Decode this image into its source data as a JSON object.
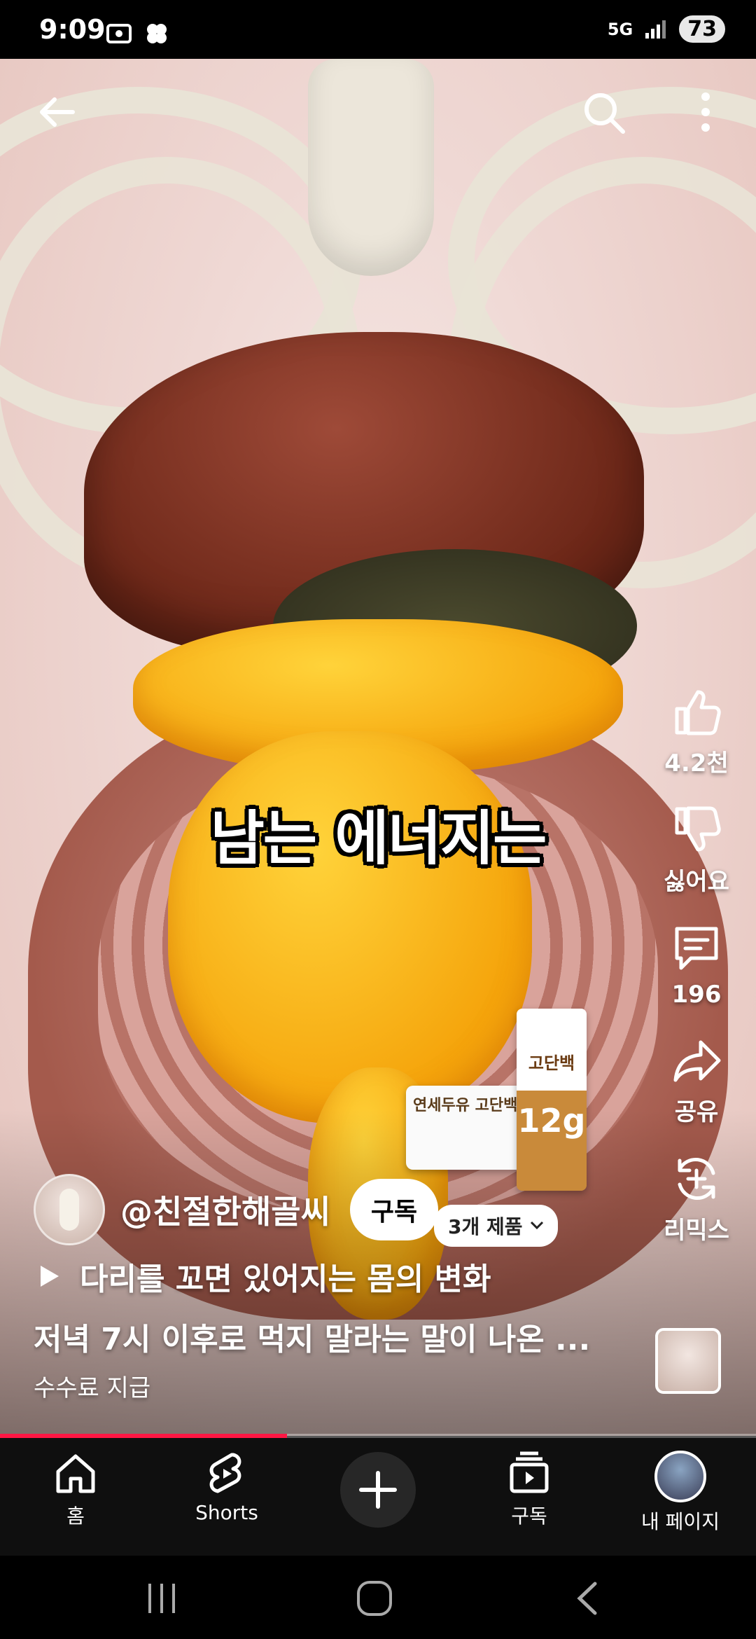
{
  "status_bar": {
    "time": "9:09",
    "network": "5G",
    "battery": "73"
  },
  "video": {
    "caption": "남는 에너지는",
    "progress": 0.38
  },
  "actions": {
    "like_count": "4.2천",
    "dislike_label": "싫어요",
    "comment_count": "196",
    "share_label": "공유",
    "remix_label": "리믹스"
  },
  "channel": {
    "handle": "@친절한해골씨",
    "subscribe_label": "구독"
  },
  "product": {
    "pill_label": "3개 제품",
    "box_text": "연세두유 고단백",
    "carton_title": "고단백",
    "carton_grams": "12g"
  },
  "related_video": "다리를 꼬면 있어지는 몸의 변화",
  "description": "저녁 7시 이후로 먹지 말라는 말이 나온 ...",
  "paid_promotion": "수수료 지급",
  "bottom_nav": {
    "home": "홈",
    "shorts": "Shorts",
    "subscriptions": "구독",
    "my_page": "내 페이지"
  },
  "colors": {
    "accent": "#ff1744",
    "nav_bg": "#0f0f0f"
  }
}
